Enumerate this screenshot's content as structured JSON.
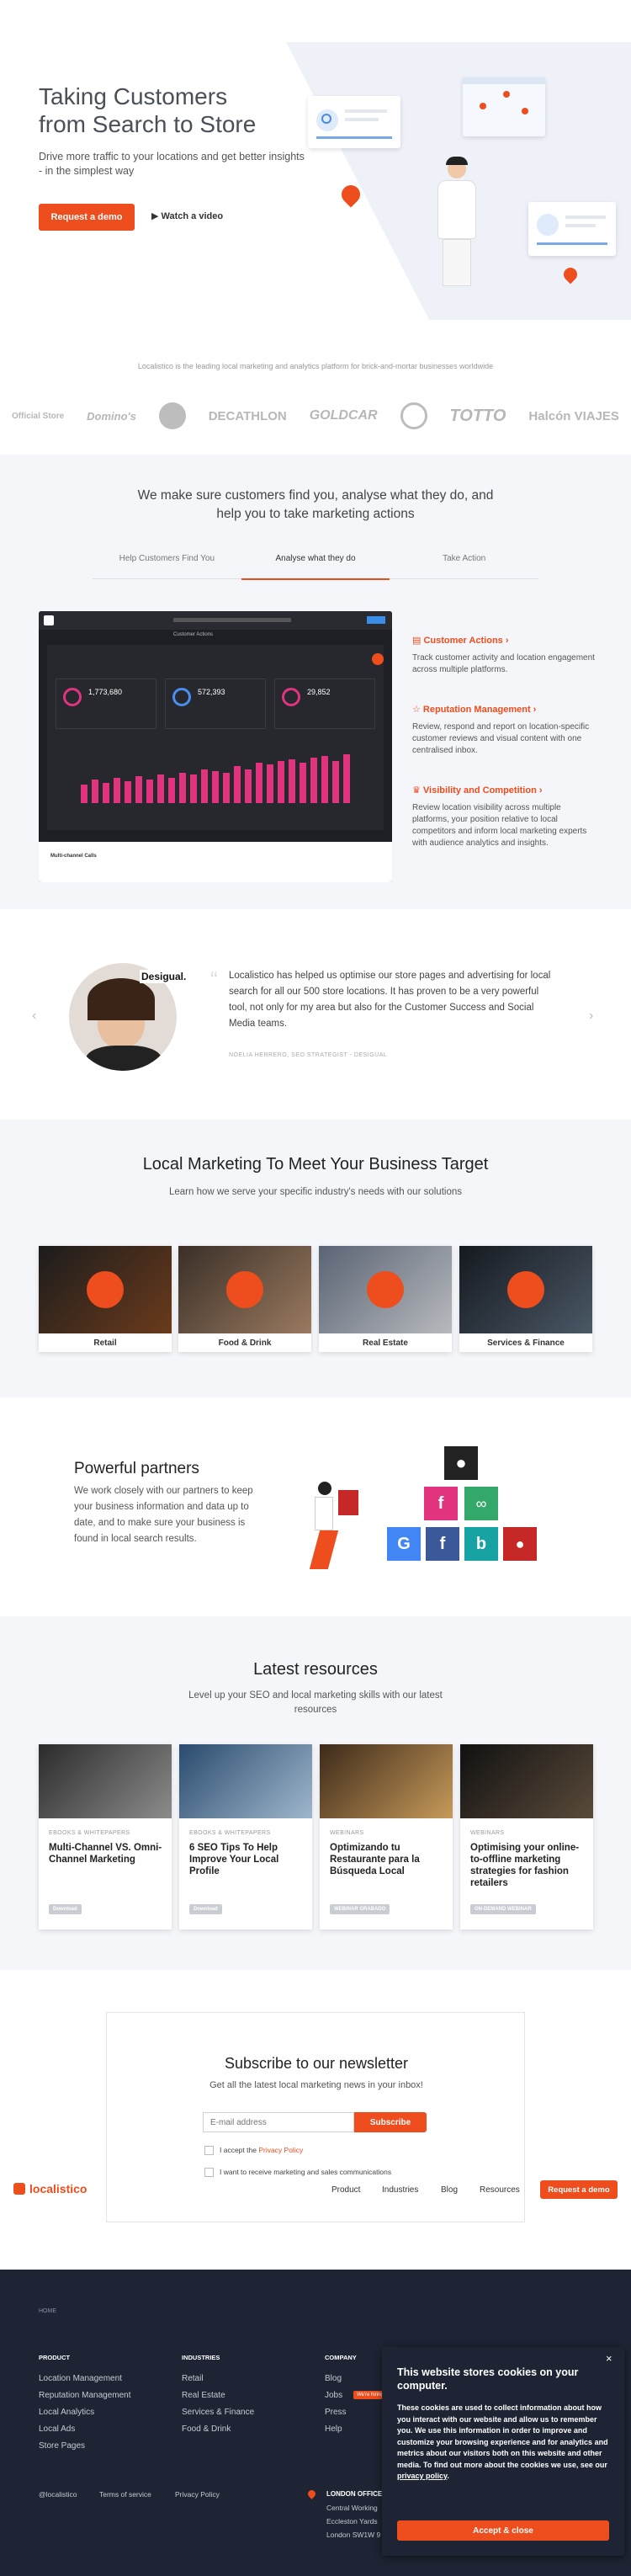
{
  "hero": {
    "title_line1": "Taking Customers",
    "title_line2": "from Search to Store",
    "subtitle": "Drive more traffic to your locations and get better insights - in the simplest way",
    "cta": "Request a demo",
    "video": "Watch a video"
  },
  "logos": {
    "caption": "Localistico is the leading local marketing and analytics platform for brick-and-mortar businesses worldwide",
    "items": [
      "Official Store",
      "Domino's",
      "Vodafone",
      "DECATHLON",
      "GOLDCAR",
      "Starbucks",
      "TOTTO",
      "Halcón VIAJES"
    ]
  },
  "features": {
    "title": "We make sure customers find you, analyse what they do, and help you to take marketing actions",
    "tabs": [
      "Help Customers Find You",
      "Analyse what they do",
      "Take Action"
    ],
    "items": [
      {
        "title": "Customer Actions",
        "text": "Track customer activity and location engagement across multiple platforms."
      },
      {
        "title": "Reputation Management",
        "text": "Review, respond and report on location-specific customer reviews and visual content with one centralised inbox."
      },
      {
        "title": "Visibility and Competition",
        "text": "Review location visibility across multiple platforms, your position relative to local competitors and inform local marketing experts with audience analytics and insights."
      }
    ],
    "dash": {
      "stats": [
        "1,773,680",
        "572,393",
        "29,852"
      ],
      "title": "Customer Actions",
      "footer": "Multi-channel Calls"
    }
  },
  "testimonial": {
    "brand": "Desigual.",
    "quote": "Localistico has helped us optimise our store pages and advertising for local search for all our 500 store locations. It has proven to be a very powerful tool, not only for my area but also for the Customer Success and Social Media teams.",
    "author": "NOELIA HERRERO, SEO STRATEGIST - DESIGUAL"
  },
  "business": {
    "title": "Local Marketing To Meet Your Business Target",
    "subtitle": "Learn how we serve your specific industry's needs with our solutions",
    "cards": [
      "Retail",
      "Food & Drink",
      "Real Estate",
      "Services & Finance"
    ]
  },
  "partners": {
    "title": "Powerful partners",
    "text": "We work closely with our partners to keep your business information and data up to date, and to make sure your business is found in local search results."
  },
  "resources": {
    "title": "Latest resources",
    "subtitle": "Level up your SEO and local marketing skills with our latest resources",
    "cards": [
      {
        "tag": "EBOOKS & WHITEPAPERS",
        "title": "Multi-Channel VS. Omni-Channel Marketing",
        "btn": "Download"
      },
      {
        "tag": "EBOOKS & WHITEPAPERS",
        "title": "6 SEO Tips To Help Improve Your Local Profile",
        "btn": "Download"
      },
      {
        "tag": "WEBINARS",
        "title": "Optimizando tu Restaurante para la Búsqueda Local",
        "btn": "WEBINAR GRABADO"
      },
      {
        "tag": "WEBINARS",
        "title": "Optimising your online-to-offline marketing strategies for fashion retailers",
        "btn": "ON-DEMAND WEBINAR"
      }
    ]
  },
  "newsletter": {
    "title": "Subscribe to our newsletter",
    "subtitle": "Get all the latest local marketing news in your inbox!",
    "placeholder": "E-mail address",
    "btn": "Subscribe",
    "check1": "I accept the ",
    "privacy": "Privacy Policy",
    "check2": "I want to receive marketing and sales communications"
  },
  "nav": {
    "logo": "localistico",
    "items": [
      "Product",
      "Industries",
      "Blog",
      "Resources"
    ],
    "cta": "Request a demo"
  },
  "footer": {
    "home": "HOME",
    "cols": [
      {
        "title": "PRODUCT",
        "items": [
          "Location Management",
          "Reputation Management",
          "Local Analytics",
          "Local Ads",
          "Store Pages"
        ]
      },
      {
        "title": "INDUSTRIES",
        "items": [
          "Retail",
          "Real Estate",
          "Services & Finance",
          "Food & Drink"
        ]
      },
      {
        "title": "COMPANY",
        "items": [
          "Blog",
          "Jobs",
          "Press",
          "Help"
        ]
      }
    ],
    "jobs_badge": "We're hiring",
    "bottom": [
      "@localistico",
      "Terms of service",
      "Privacy Policy"
    ],
    "office": {
      "title": "LONDON OFFICE",
      "lines": [
        "Central Working",
        "Eccleston Yards",
        "London SW1W 9"
      ]
    }
  },
  "cookie": {
    "title": "This website stores cookies on your computer.",
    "text": "These cookies are used to collect information about how you interact with our website and allow us to remember you. We use this information in order to improve and customize your browsing experience and for analytics and metrics about our visitors both on this website and other media. To find out more about the cookies we use, see our ",
    "link": "privacy policy",
    "btn": "Accept & close",
    "close": "×"
  }
}
